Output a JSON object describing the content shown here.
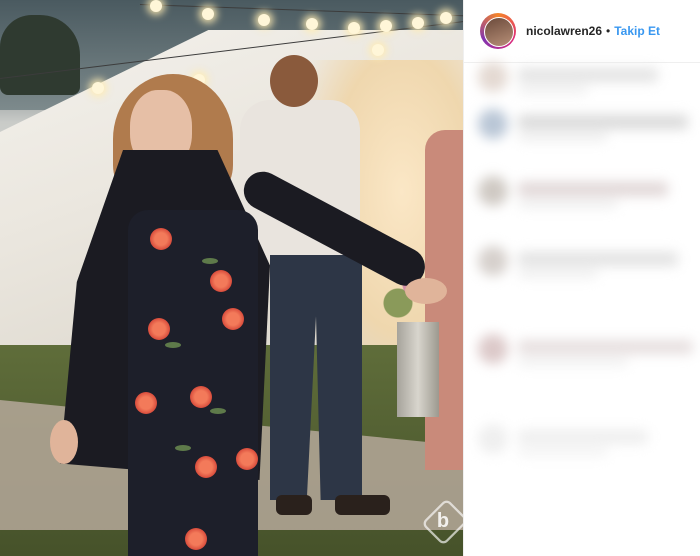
{
  "post": {
    "username": "nicolawren26",
    "separator": "•",
    "follow_label": "Takip Et"
  },
  "colors": {
    "follow": "#3897f0",
    "username": "#262626"
  },
  "comments_blurred": true
}
